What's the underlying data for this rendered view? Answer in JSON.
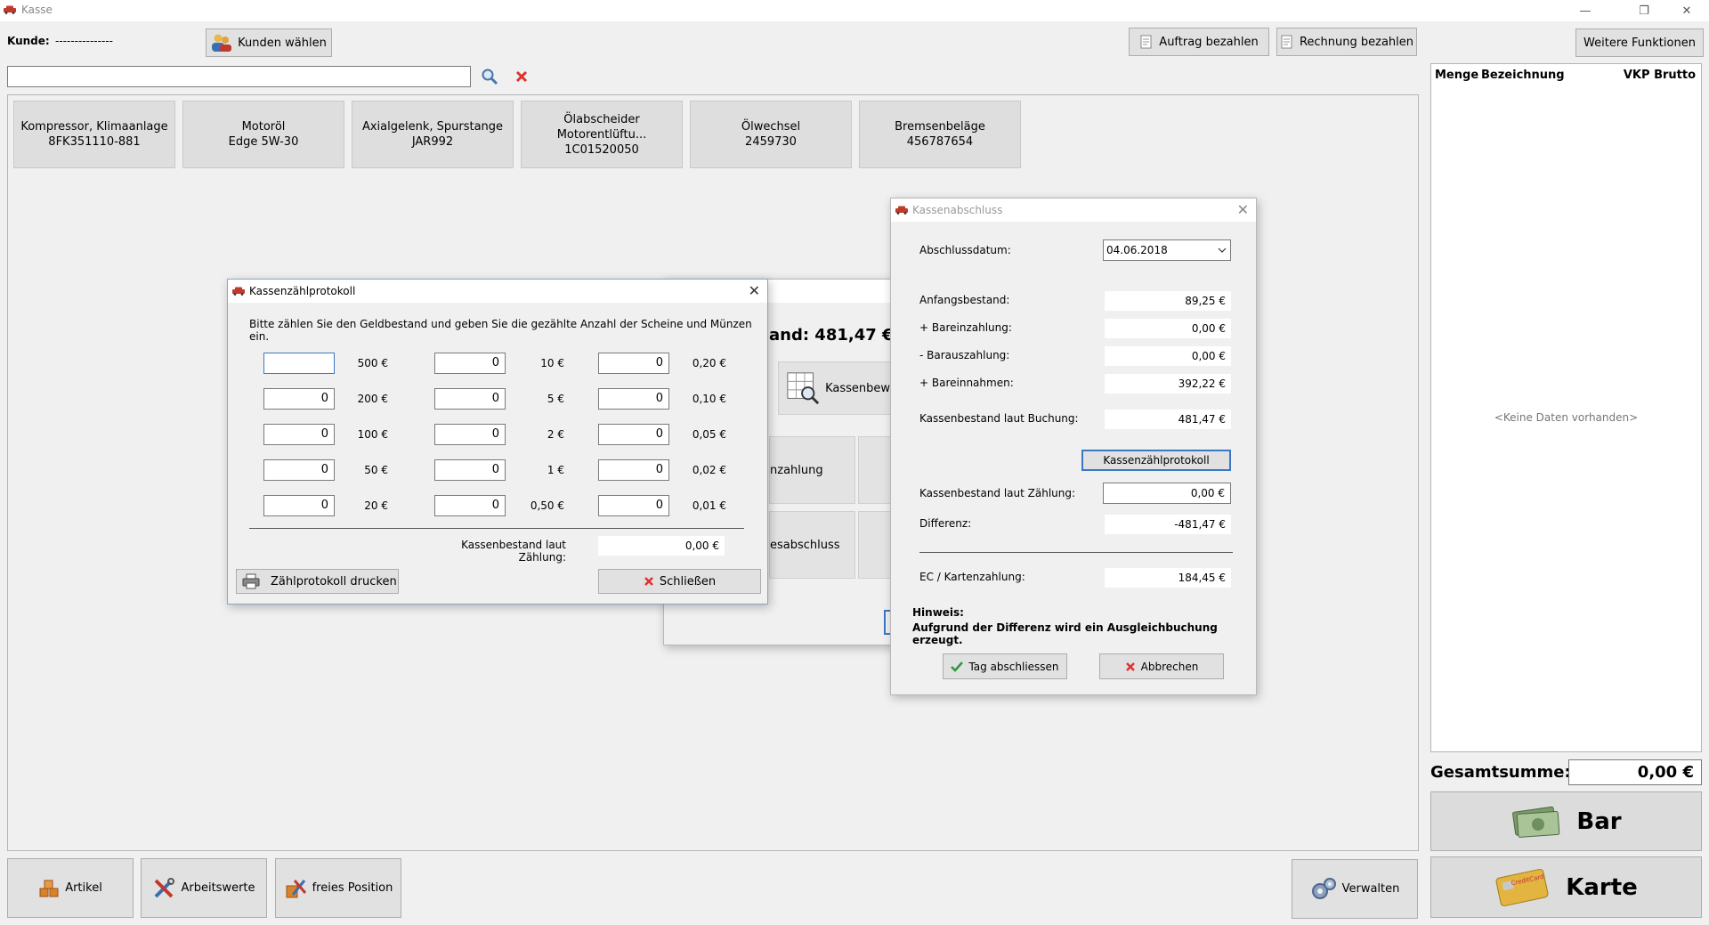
{
  "window": {
    "title": "Kasse"
  },
  "header": {
    "customer_label": "Kunde:",
    "customer_value": "---------------",
    "choose_customer": "Kunden wählen",
    "pay_order": "Auftrag bezahlen",
    "pay_invoice": "Rechnung bezahlen",
    "more_functions": "Weitere Funktionen"
  },
  "search": {
    "value": "",
    "placeholder": ""
  },
  "tiles": [
    {
      "name": "Kompressor, Klimaanlage",
      "code": "8FK351110-881"
    },
    {
      "name": "Motoröl",
      "code": "Edge 5W-30"
    },
    {
      "name": "Axialgelenk, Spurstange",
      "code": "JAR992"
    },
    {
      "name": "Ölabscheider Motorentlüftu...",
      "code": "1C01520050"
    },
    {
      "name": "Ölwechsel",
      "code": "2459730"
    },
    {
      "name": "Bremsenbeläge",
      "code": "456787654"
    }
  ],
  "cart": {
    "col_qty": "Menge",
    "col_desc": "Bezeichnung",
    "col_price": "VKP Brutto",
    "empty": "<Keine Daten vorhanden>",
    "total_label": "Gesamtsumme:",
    "total_value": "0,00 €",
    "cash": "Bar",
    "card": "Karte"
  },
  "bottom": {
    "articles": "Artikel",
    "work_values": "Arbeitswerte",
    "free_position": "freies Position",
    "manage": "Verwalten"
  },
  "behind": {
    "balance_text": "and: 481,47 €",
    "btn1": "Kassenbewe",
    "btn2": "nzahlung",
    "btn3": "esabschluss"
  },
  "count_dialog": {
    "title": "Kassenzählprotokoll",
    "instruction": "Bitte zählen Sie den Geldbestand und geben Sie die gezählte Anzahl der Scheine und Münzen ein.",
    "rows": [
      [
        {
          "v": "",
          "d": "500 €"
        },
        {
          "v": "0",
          "d": "10 €"
        },
        {
          "v": "0",
          "d": "0,20 €"
        }
      ],
      [
        {
          "v": "0",
          "d": "200 €"
        },
        {
          "v": "0",
          "d": "5 €"
        },
        {
          "v": "0",
          "d": "0,10 €"
        }
      ],
      [
        {
          "v": "0",
          "d": "100 €"
        },
        {
          "v": "0",
          "d": "2 €"
        },
        {
          "v": "0",
          "d": "0,05 €"
        }
      ],
      [
        {
          "v": "0",
          "d": "50 €"
        },
        {
          "v": "0",
          "d": "1 €"
        },
        {
          "v": "0",
          "d": "0,02 €"
        }
      ],
      [
        {
          "v": "0",
          "d": "20 €"
        },
        {
          "v": "0",
          "d": "0,50 €"
        },
        {
          "v": "0",
          "d": "0,01 €"
        }
      ]
    ],
    "total_label": "Kassenbestand laut Zählung:",
    "total_value": "0,00 €",
    "print_btn": "Zählprotokoll drucken",
    "close_btn": "Schließen"
  },
  "close_dialog": {
    "title": "Kassenabschluss",
    "date_label": "Abschlussdatum:",
    "date_value": "04.06.2018",
    "opening_label": "Anfangsbestand:",
    "opening_value": "89,25 €",
    "deposit_label": "+ Bareinzahlung:",
    "deposit_value": "0,00 €",
    "withdraw_label": "-  Barauszahlung:",
    "withdraw_value": "0,00 €",
    "income_label": "+ Bareinnahmen:",
    "income_value": "392,22 €",
    "booked_label": "Kassenbestand laut Buchung:",
    "booked_value": "481,47 €",
    "protocol_btn": "Kassenzählprotokoll",
    "counted_label": "Kassenbestand laut Zählung:",
    "counted_value": "0,00 €",
    "diff_label": "Differenz:",
    "diff_value": "-481,47 €",
    "ec_label": "EC / Kartenzahlung:",
    "ec_value": "184,45 €",
    "hint_title": "Hinweis:",
    "hint_text": "Aufgrund der Differenz wird ein Ausgleichbuchung erzeugt.",
    "confirm_btn": "Tag abschliessen",
    "cancel_btn": "Abbrechen"
  }
}
